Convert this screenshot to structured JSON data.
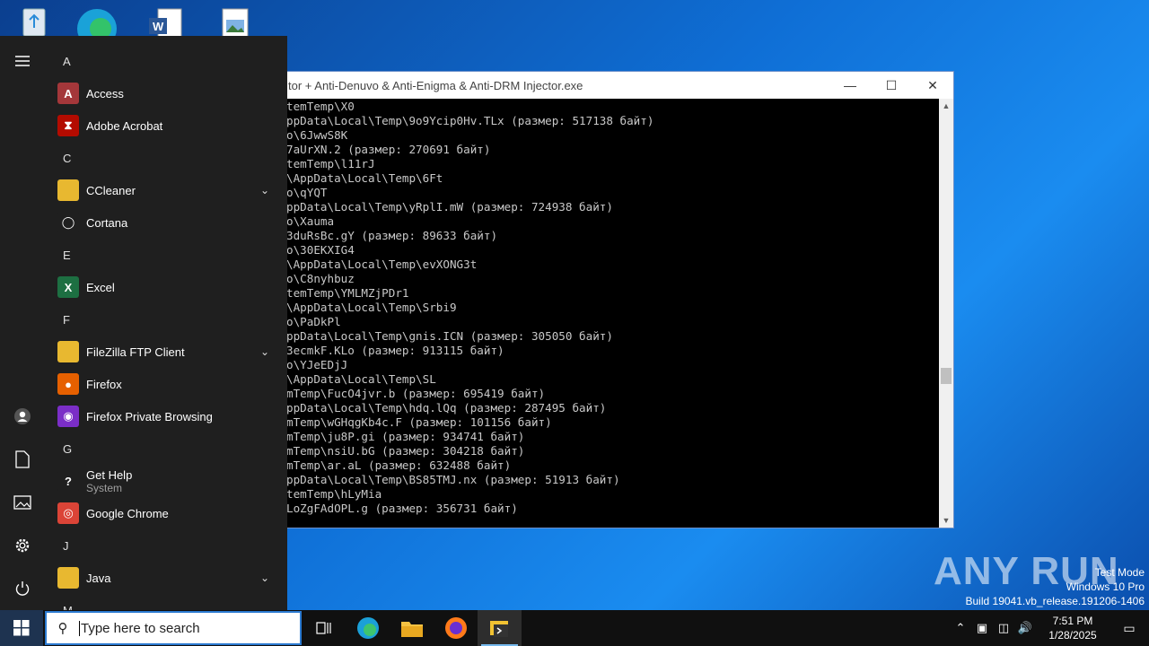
{
  "desktop": {
    "icons": [
      "recycle-bin-icon",
      "edge-icon",
      "word-doc-icon",
      "image-file-icon"
    ],
    "watermark_brand": "ANY RUN",
    "test_mode": "Test Mode",
    "windows_edition": "Windows 10 Pro",
    "build": "Build 19041.vb_release.191206-1406"
  },
  "console": {
    "title": "tor + Anti-Denuvo & Anti-Enigma & Anti-DRM Injector.exe",
    "lines": [
      "temTemp\\X0",
      "ppData\\Local\\Temp\\9o9Ycip0Hv.TLx (размер: 517138 байт)",
      "o\\6JwwS8K",
      "7aUrXN.2 (размер: 270691 байт)",
      "temTemp\\l11rJ",
      "\\AppData\\Local\\Temp\\6Ft",
      "o\\qYQT",
      "ppData\\Local\\Temp\\yRplI.mW (размер: 724938 байт)",
      "o\\Xauma",
      "3duRsBc.gY (размер: 89633 байт)",
      "o\\30EKXIG4",
      "\\AppData\\Local\\Temp\\evXONG3t",
      "o\\C8nyhbuz",
      "temTemp\\YMLMZjPDr1",
      "\\AppData\\Local\\Temp\\Srbi9",
      "o\\PaDkPl",
      "ppData\\Local\\Temp\\gnis.ICN (размер: 305050 байт)",
      "3ecmkF.KLo (размер: 913115 байт)",
      "o\\YJeEDjJ",
      "\\AppData\\Local\\Temp\\SL",
      "mTemp\\FucO4jvr.b (размер: 695419 байт)",
      "ppData\\Local\\Temp\\hdq.lQq (размер: 287495 байт)",
      "mTemp\\wGHqgKb4c.F (размер: 101156 байт)",
      "mTemp\\ju8P.gi (размер: 934741 байт)",
      "mTemp\\nsiU.bG (размер: 304218 байт)",
      "mTemp\\ar.aL (размер: 632488 байт)",
      "ppData\\Local\\Temp\\BS85TMJ.nx (размер: 51913 байт)",
      "temTemp\\hLyMia",
      "LoZgFAdOPL.g (размер: 356731 байт)"
    ]
  },
  "start_menu": {
    "entries": [
      {
        "kind": "letter",
        "label": "A"
      },
      {
        "kind": "app",
        "label": "Access",
        "icon": "access-icon",
        "color": "#a4373a",
        "glyph": "A"
      },
      {
        "kind": "app",
        "label": "Adobe Acrobat",
        "icon": "acrobat-icon",
        "color": "#b30b00",
        "glyph": "⧗"
      },
      {
        "kind": "letter",
        "label": "C"
      },
      {
        "kind": "app",
        "label": "CCleaner",
        "icon": "folder-icon",
        "color": "#e8b830",
        "glyph": "",
        "expand": true
      },
      {
        "kind": "app",
        "label": "Cortana",
        "icon": "cortana-icon",
        "color": "#1f1f1f",
        "glyph": "◯"
      },
      {
        "kind": "letter",
        "label": "E"
      },
      {
        "kind": "app",
        "label": "Excel",
        "icon": "excel-icon",
        "color": "#1d6f42",
        "glyph": "X"
      },
      {
        "kind": "letter",
        "label": "F"
      },
      {
        "kind": "app",
        "label": "FileZilla FTP Client",
        "icon": "folder-icon",
        "color": "#e8b830",
        "glyph": "",
        "expand": true
      },
      {
        "kind": "app",
        "label": "Firefox",
        "icon": "firefox-icon",
        "color": "#e66000",
        "glyph": "●"
      },
      {
        "kind": "app",
        "label": "Firefox Private Browsing",
        "icon": "firefox-private-icon",
        "color": "#7b2ec7",
        "glyph": "◉"
      },
      {
        "kind": "letter",
        "label": "G"
      },
      {
        "kind": "app",
        "label": "Get Help",
        "sub": "System",
        "icon": "get-help-icon",
        "color": "#1f1f1f",
        "glyph": "?"
      },
      {
        "kind": "app",
        "label": "Google Chrome",
        "icon": "chrome-icon",
        "color": "#db4437",
        "glyph": "◎"
      },
      {
        "kind": "letter",
        "label": "J"
      },
      {
        "kind": "app",
        "label": "Java",
        "icon": "folder-icon",
        "color": "#e8b830",
        "glyph": "",
        "expand": true
      },
      {
        "kind": "letter",
        "label": "M"
      }
    ]
  },
  "taskbar": {
    "search_placeholder": "Type here to search",
    "time": "7:51 PM",
    "date": "1/28/2025"
  }
}
